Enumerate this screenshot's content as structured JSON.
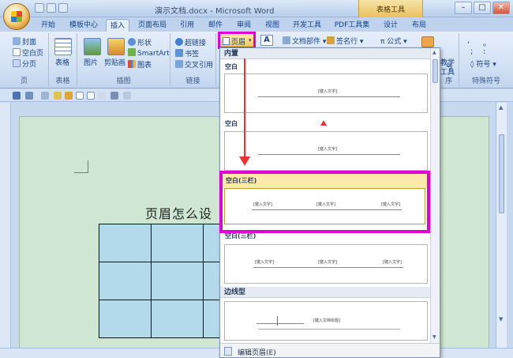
{
  "window": {
    "title": "演示文档.docx - Microsoft Word",
    "context_tab": "表格工具",
    "buttons": [
      "–",
      "□",
      "✕"
    ]
  },
  "tabs": [
    "开始",
    "模板中心",
    "插入",
    "页面布局",
    "引用",
    "邮件",
    "审阅",
    "视图",
    "开发工具",
    "PDF工具集",
    "设计",
    "布局"
  ],
  "active_tab": "插入",
  "ribbon": {
    "pages_group": {
      "items": [
        "封面",
        "空白页",
        "分页"
      ],
      "label": "页"
    },
    "table_group": {
      "button": "表格",
      "label": "表格"
    },
    "illust_group": {
      "picture": "图片",
      "clipart": "剪贴画",
      "shapes": "形状",
      "smartart": "SmartArt",
      "chart": "图表",
      "label": "插图"
    },
    "links_group": {
      "hyperlink": "超链接",
      "bookmark": "书签",
      "crossref": "交叉引用",
      "label": "链接"
    },
    "header_button": "页眉",
    "text_group": {
      "quickparts": "文档部件",
      "signature": "签名行",
      "formula": "公式"
    },
    "right_group": {
      "teach": "教学",
      "tools": "工具",
      "label": "特殊符号",
      "symbol": "符号",
      "symbol2": "号"
    },
    "grp_label_right": "序"
  },
  "dropdown": {
    "section_builtin": "内置",
    "items": [
      {
        "name": "空白",
        "placeholder": "[键入文字]"
      },
      {
        "name": "空白",
        "placeholder": "[键入文字]"
      },
      {
        "name": "空白(三栏)",
        "placeholder": "[键入文字]"
      },
      {
        "name": "空白(三栏)",
        "placeholder": "[键入文字]"
      }
    ],
    "section_border": "边线型",
    "border_placeholder": "[键入文档标题]",
    "footer": "编辑页眉(E)"
  },
  "document": {
    "title": "页眉怎么设"
  }
}
